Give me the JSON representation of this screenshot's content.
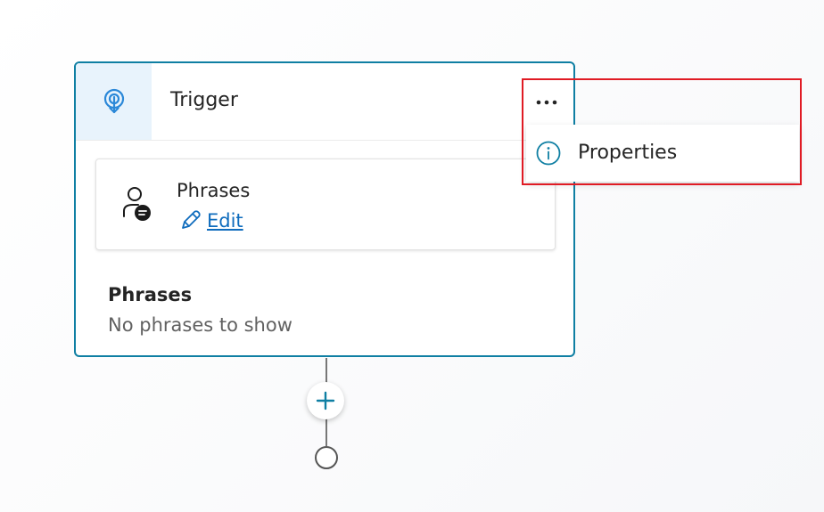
{
  "trigger_node": {
    "title": "Trigger",
    "icon": "trigger-icon",
    "more_options_icon": "more-icon",
    "inner_card": {
      "title": "Phrases",
      "icon": "person-chat-icon",
      "edit_label": "Edit",
      "edit_icon": "pencil-icon"
    },
    "section": {
      "title": "Phrases",
      "empty_text": "No phrases to show"
    }
  },
  "menu": {
    "items": [
      {
        "label": "Properties",
        "icon": "info-icon"
      }
    ]
  },
  "canvas": {
    "add_node_icon": "plus-icon"
  },
  "colors": {
    "accent": "#0f7fa3",
    "link": "#0f6cbd",
    "highlight": "#e01b24",
    "header_icon_bg": "#e8f3fc"
  }
}
